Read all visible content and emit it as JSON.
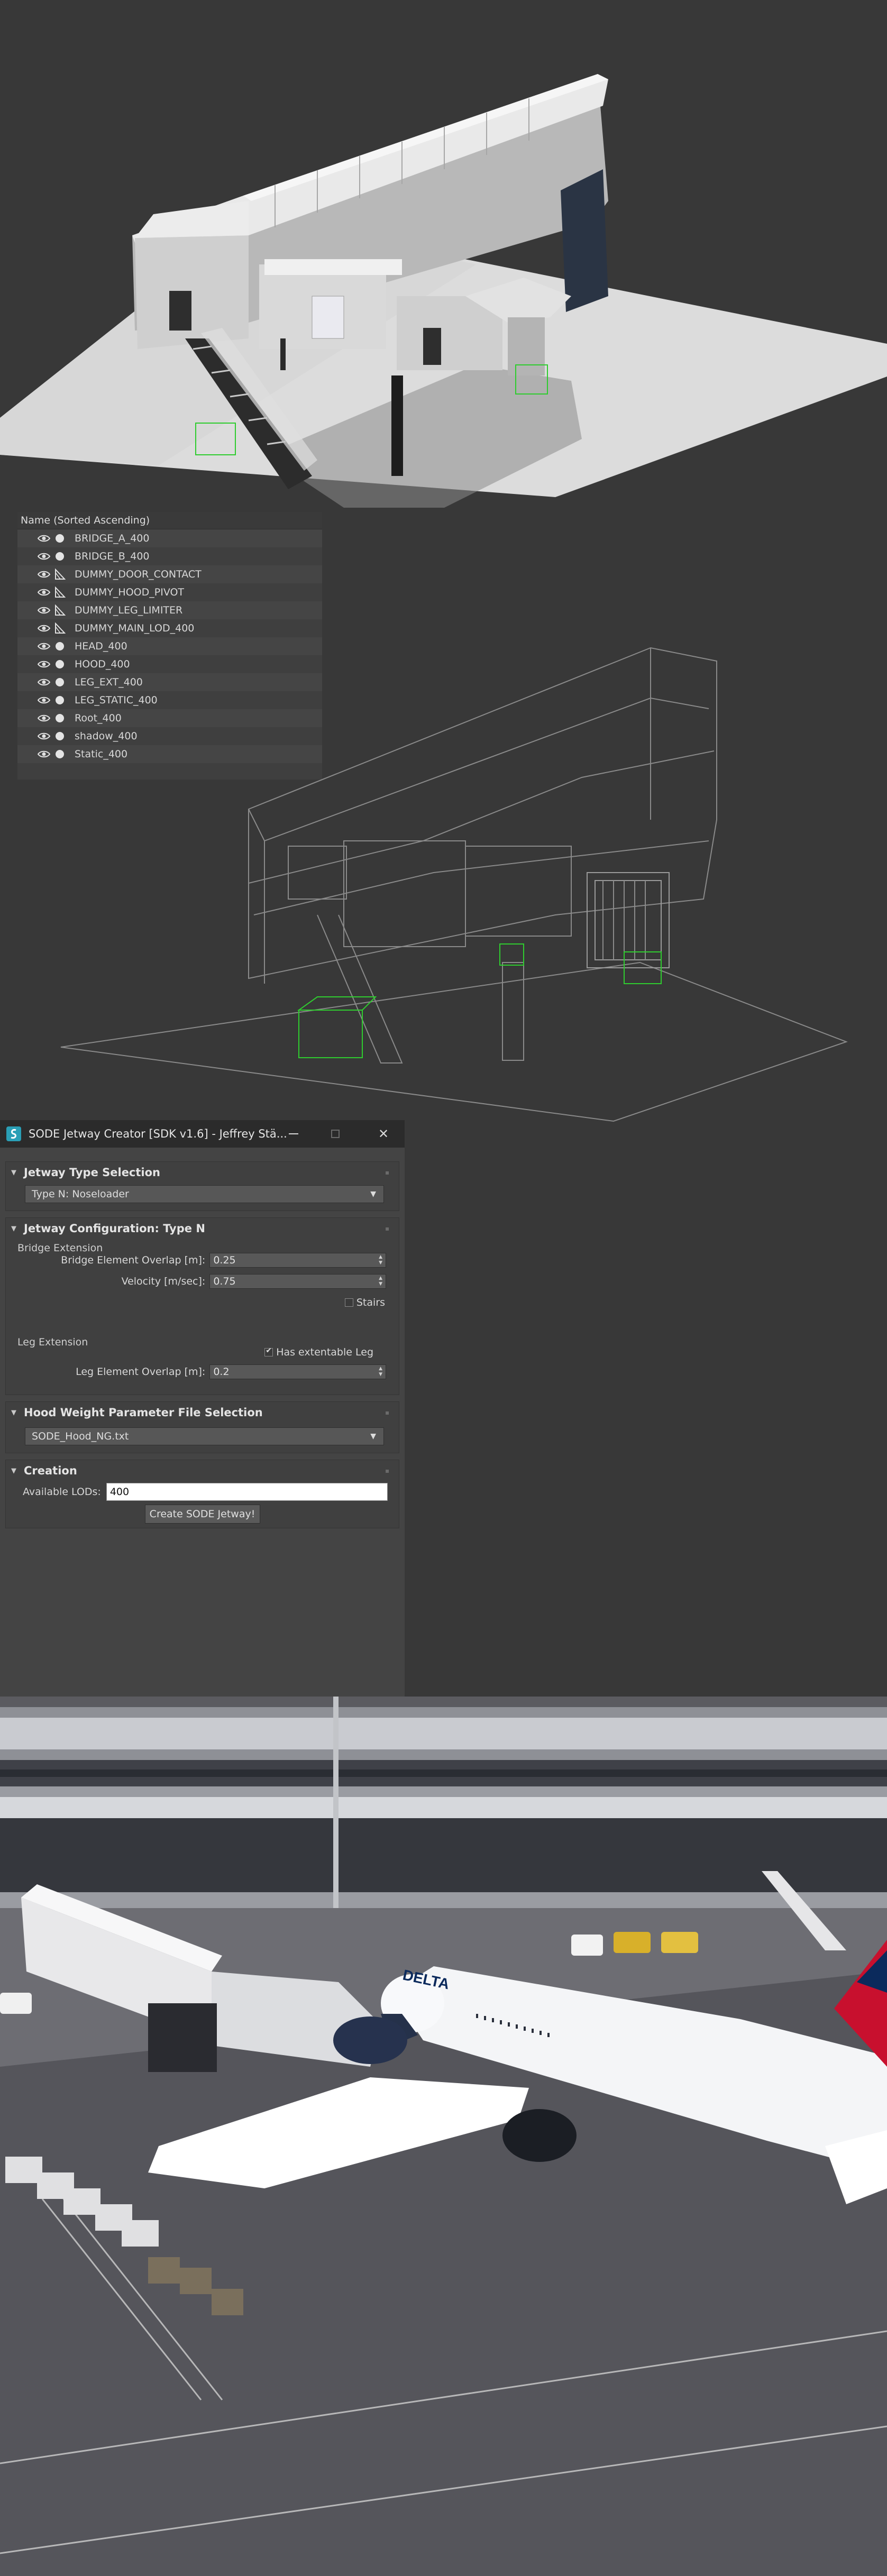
{
  "scene_explorer": {
    "header": "Name (Sorted Ascending)",
    "items": [
      {
        "label": "BRIDGE_A_400",
        "kind": "geometry-sphere-icon"
      },
      {
        "label": "BRIDGE_B_400",
        "kind": "geometry-sphere-icon"
      },
      {
        "label": "DUMMY_DOOR_CONTACT",
        "kind": "helper-triangle-icon"
      },
      {
        "label": "DUMMY_HOOD_PIVOT",
        "kind": "helper-triangle-icon"
      },
      {
        "label": "DUMMY_LEG_LIMITER",
        "kind": "helper-triangle-icon"
      },
      {
        "label": "DUMMY_MAIN_LOD_400",
        "kind": "helper-triangle-icon"
      },
      {
        "label": "HEAD_400",
        "kind": "geometry-sphere-icon"
      },
      {
        "label": "HOOD_400",
        "kind": "geometry-sphere-icon"
      },
      {
        "label": "LEG_EXT_400",
        "kind": "geometry-sphere-icon"
      },
      {
        "label": "LEG_STATIC_400",
        "kind": "geometry-sphere-icon"
      },
      {
        "label": "Root_400",
        "kind": "geometry-sphere-icon"
      },
      {
        "label": "shadow_400",
        "kind": "geometry-sphere-icon"
      },
      {
        "label": "Static_400",
        "kind": "geometry-sphere-icon"
      }
    ]
  },
  "dialog": {
    "title": "SODE Jetway Creator [SDK v1.6] - Jeffrey Stä...",
    "type_rollout": {
      "title": "Jetway Type Selection",
      "selected": "Type N: Noseloader"
    },
    "config_rollout": {
      "title": "Jetway Configuration: Type N",
      "bridge_group": "Bridge Extension",
      "overlap_label": "Bridge Element Overlap [m]:",
      "overlap_value": "0.25",
      "velocity_label": "Velocity [m/sec]:",
      "velocity_value": "0.75",
      "stairs_label": "Stairs",
      "leg_group": "Leg Extension",
      "extendable_label": "Has extentable Leg",
      "leg_overlap_label": "Leg Element Overlap [m]:",
      "leg_overlap_value": "0.2"
    },
    "hood_rollout": {
      "title": "Hood Weight Parameter File Selection",
      "selected": "SODE_Hood_NG.txt"
    },
    "creation_rollout": {
      "title": "Creation",
      "lods_label": "Available LODs:",
      "lods_value": "400",
      "create_button": "Create SODE Jetway!"
    },
    "stairs_checked": false,
    "extendable_checked": true
  },
  "airliner_livery": "DELTA",
  "colors": {
    "background": "#383838",
    "accent_icon": "#2a9fb6",
    "wireframe_helper": "#2fcc2f",
    "delta_red": "#c8102e",
    "delta_blue": "#0b2a5c"
  }
}
